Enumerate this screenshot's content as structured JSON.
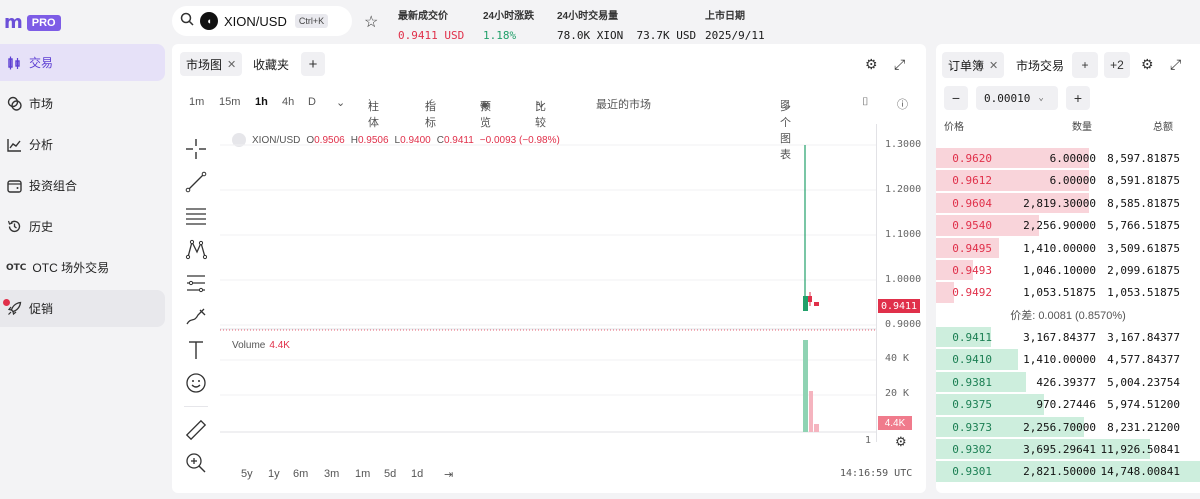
{
  "brand": {
    "mark": "m",
    "badge": "PRO"
  },
  "sidebar": {
    "items": [
      {
        "label": "交易",
        "icon": "candles-icon"
      },
      {
        "label": "市场",
        "icon": "coins-icon"
      },
      {
        "label": "分析",
        "icon": "chart-line-icon"
      },
      {
        "label": "投资组合",
        "icon": "wallet-icon"
      },
      {
        "label": "历史",
        "icon": "history-icon"
      },
      {
        "label": "OTC 场外交易",
        "icon": "otc-icon",
        "tag": "OTC"
      },
      {
        "label": "促销",
        "icon": "rocket-icon"
      }
    ]
  },
  "header": {
    "pair": "XION/USD",
    "shortcut": "Ctrl+K",
    "last_price_label": "最新成交价",
    "last_price": "0.9411 USD",
    "change_label": "24小时涨跌",
    "change": "1.18%",
    "volume_label": "24小时交易量",
    "volume_base": "78.0K XION",
    "volume_quote": "73.7K USD",
    "listing_label": "上市日期",
    "listing_date": "2025/9/11"
  },
  "chart_panel": {
    "tabs": [
      {
        "label": "市场图"
      },
      {
        "label": "收藏夹"
      }
    ],
    "timeframes": [
      "1m",
      "15m",
      "1h",
      "4h",
      "D"
    ],
    "selected_timeframe": "1h",
    "toolbar": {
      "bars": "柱体",
      "indicators": "指标",
      "preview": "预览",
      "compare": "比较",
      "recent": "最近的市场",
      "multi": "多个图表"
    },
    "ohlc": {
      "symbol": "XION/USD",
      "o_label": "O",
      "o": "0.9506",
      "h_label": "H",
      "h": "0.9506",
      "l_label": "L",
      "l": "0.9400",
      "c_label": "C",
      "c": "0.9411",
      "change": "−0.0093 (−0.98%)"
    },
    "volume_label": "Volume",
    "volume_value": "4.4K",
    "current_price_tag": "0.9411",
    "current_volume_tag": "4.4K",
    "price_ticks": [
      "1.3000",
      "1.2000",
      "1.1000",
      "1.0000",
      "0.9000"
    ],
    "volume_ticks": [
      "40 K",
      "20 K"
    ],
    "ranges": [
      "5y",
      "1y",
      "6m",
      "3m",
      "1m",
      "5d",
      "1d"
    ],
    "time": "14:16:59 UTC",
    "time_axis_label": "1"
  },
  "order_book": {
    "tabs": [
      {
        "label": "订单簿"
      },
      {
        "label": "市场交易"
      }
    ],
    "more": "+2",
    "tick_size": "0.00010",
    "headers": {
      "price": "价格",
      "qty": "数量",
      "total": "总额"
    },
    "asks": [
      {
        "price": "0.9620",
        "qty": "6.00000",
        "total": "8,597.81875",
        "depth": 0.58
      },
      {
        "price": "0.9612",
        "qty": "6.00000",
        "total": "8,591.81875",
        "depth": 0.58
      },
      {
        "price": "0.9604",
        "qty": "2,819.30000",
        "total": "8,585.81875",
        "depth": 0.58
      },
      {
        "price": "0.9540",
        "qty": "2,256.90000",
        "total": "5,766.51875",
        "depth": 0.39
      },
      {
        "price": "0.9495",
        "qty": "1,410.00000",
        "total": "3,509.61875",
        "depth": 0.24
      },
      {
        "price": "0.9493",
        "qty": "1,046.10000",
        "total": "2,099.61875",
        "depth": 0.14
      },
      {
        "price": "0.9492",
        "qty": "1,053.51875",
        "total": "1,053.51875",
        "depth": 0.07
      }
    ],
    "spread": "价差: 0.0081 (0.8570%)",
    "bids": [
      {
        "price": "0.9411",
        "qty": "3,167.84377",
        "total": "3,167.84377",
        "depth": 0.21
      },
      {
        "price": "0.9410",
        "qty": "1,410.00000",
        "total": "4,577.84377",
        "depth": 0.31
      },
      {
        "price": "0.9381",
        "qty": "426.39377",
        "total": "5,004.23754",
        "depth": 0.34
      },
      {
        "price": "0.9375",
        "qty": "970.27446",
        "total": "5,974.51200",
        "depth": 0.41
      },
      {
        "price": "0.9373",
        "qty": "2,256.70000",
        "total": "8,231.21200",
        "depth": 0.56
      },
      {
        "price": "0.9302",
        "qty": "3,695.29641",
        "total": "11,926.50841",
        "depth": 0.81
      },
      {
        "price": "0.9301",
        "qty": "2,821.50000",
        "total": "14,748.00841",
        "depth": 1.0
      }
    ]
  },
  "colors": {
    "accent": "#6b4fd8",
    "up": "#21a06a",
    "down": "#e0304a"
  }
}
